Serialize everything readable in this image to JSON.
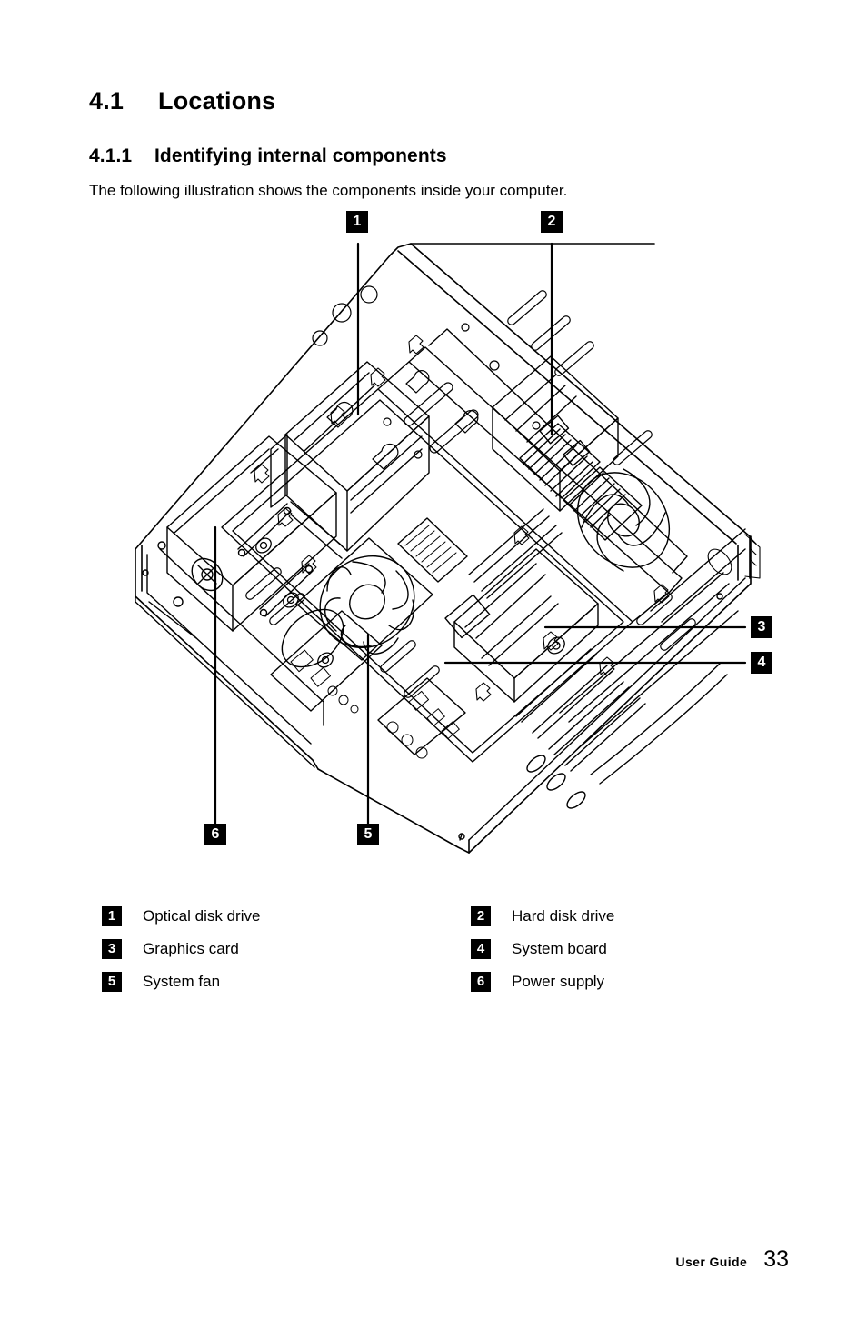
{
  "document": {
    "section_number": "4.1",
    "section_title": "Locations",
    "subsection_number": "4.1.1",
    "subsection_title": "Identifying internal components",
    "intro_text": "The following illustration shows the components inside your computer."
  },
  "figure": {
    "alt": "Exploded interior view of a desktop computer chassis with six numbered callouts",
    "callouts": [
      {
        "number": "1",
        "label": "Optical disk drive"
      },
      {
        "number": "2",
        "label": "Hard disk drive"
      },
      {
        "number": "3",
        "label": "Graphics card"
      },
      {
        "number": "4",
        "label": "System board"
      },
      {
        "number": "5",
        "label": "System fan"
      },
      {
        "number": "6",
        "label": "Power supply"
      }
    ]
  },
  "legend": {
    "rows": [
      {
        "left": {
          "number": "1",
          "label": "Optical disk drive"
        },
        "right": {
          "number": "2",
          "label": "Hard disk drive"
        }
      },
      {
        "left": {
          "number": "3",
          "label": "Graphics card"
        },
        "right": {
          "number": "4",
          "label": "System board"
        }
      },
      {
        "left": {
          "number": "5",
          "label": "System fan"
        },
        "right": {
          "number": "6",
          "label": "Power supply"
        }
      }
    ]
  },
  "footer": {
    "label": "User Guide",
    "page_number": "33"
  },
  "colors": {
    "text": "#000000",
    "badge_background": "#000000",
    "badge_text": "#ffffff",
    "page_background": "#ffffff"
  }
}
